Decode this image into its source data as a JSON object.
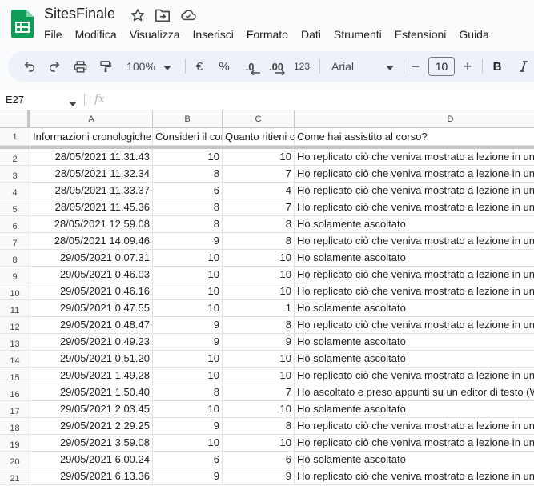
{
  "app": {
    "title": "SitesFinale",
    "menu": [
      "File",
      "Modifica",
      "Visualizza",
      "Inserisci",
      "Formato",
      "Dati",
      "Strumenti",
      "Estensioni",
      "Guida"
    ]
  },
  "toolbar": {
    "zoom": "100%",
    "currency": "€",
    "percent": "%",
    "decrease_decimals": ".0",
    "increase_decimals": ".00",
    "number_format": "123",
    "font": "Arial",
    "font_size": "10",
    "minus": "−",
    "plus": "+",
    "bold": "B"
  },
  "formula_bar": {
    "name_box": "E27",
    "fx": "fx"
  },
  "grid": {
    "columns": [
      "A",
      "B",
      "C",
      "D"
    ],
    "row_numbers": [
      "1",
      "2",
      "3",
      "4",
      "5",
      "6",
      "7",
      "8",
      "9",
      "10",
      "11",
      "12",
      "13",
      "14",
      "15",
      "16",
      "17",
      "18",
      "19",
      "20",
      "21"
    ],
    "header_row": [
      "Informazioni cronologiche",
      "Consideri il corso",
      "Quanto ritieni che",
      "Come hai assistito al corso?"
    ],
    "rows": [
      [
        "28/05/2021 11.31.43",
        "10",
        "10",
        "Ho replicato ciò che veniva mostrato a lezione in un editor di testo"
      ],
      [
        "28/05/2021 11.32.34",
        "8",
        "7",
        "Ho replicato ciò che veniva mostrato a lezione in un editor di testo"
      ],
      [
        "28/05/2021 11.33.37",
        "6",
        "4",
        "Ho replicato ciò che veniva mostrato a lezione in un editor di testo"
      ],
      [
        "28/05/2021 11.45.36",
        "8",
        "7",
        "Ho replicato ciò che veniva mostrato a lezione in un editor di testo"
      ],
      [
        "28/05/2021 12.59.08",
        "8",
        "8",
        "Ho solamente ascoltato"
      ],
      [
        "28/05/2021 14.09.46",
        "9",
        "8",
        "Ho replicato ciò che veniva mostrato a lezione in un editor di testo"
      ],
      [
        "29/05/2021 0.07.31",
        "10",
        "10",
        "Ho solamente ascoltato"
      ],
      [
        "29/05/2021 0.46.03",
        "10",
        "10",
        "Ho replicato ciò che veniva mostrato a lezione in un editor di testo"
      ],
      [
        "29/05/2021 0.46.16",
        "10",
        "10",
        "Ho replicato ciò che veniva mostrato a lezione in un editor di testo"
      ],
      [
        "29/05/2021 0.47.55",
        "10",
        "1",
        "Ho solamente ascoltato"
      ],
      [
        "29/05/2021 0.48.47",
        "9",
        "8",
        "Ho replicato ciò che veniva mostrato a lezione in un editor di testo"
      ],
      [
        "29/05/2021 0.49.23",
        "9",
        "9",
        "Ho solamente ascoltato"
      ],
      [
        "29/05/2021 0.51.20",
        "10",
        "10",
        "Ho solamente ascoltato"
      ],
      [
        "29/05/2021 1.49.28",
        "10",
        "10",
        "Ho replicato ciò che veniva mostrato a lezione in un editor di testo"
      ],
      [
        "29/05/2021 1.50.40",
        "8",
        "7",
        "Ho ascoltato e preso appunti su un editor di testo (Word o simili)"
      ],
      [
        "29/05/2021 2.03.45",
        "10",
        "10",
        "Ho solamente ascoltato"
      ],
      [
        "29/05/2021 2.29.25",
        "9",
        "8",
        "Ho replicato ciò che veniva mostrato a lezione in un editor di testo"
      ],
      [
        "29/05/2021 3.59.08",
        "10",
        "10",
        "Ho replicato ciò che veniva mostrato a lezione in un editor di testo"
      ],
      [
        "29/05/2021 6.00.24",
        "6",
        "6",
        "Ho solamente ascoltato"
      ],
      [
        "29/05/2021 6.13.36",
        "9",
        "9",
        "Ho replicato ciò che veniva mostrato a lezione in un editor di testo"
      ]
    ]
  }
}
